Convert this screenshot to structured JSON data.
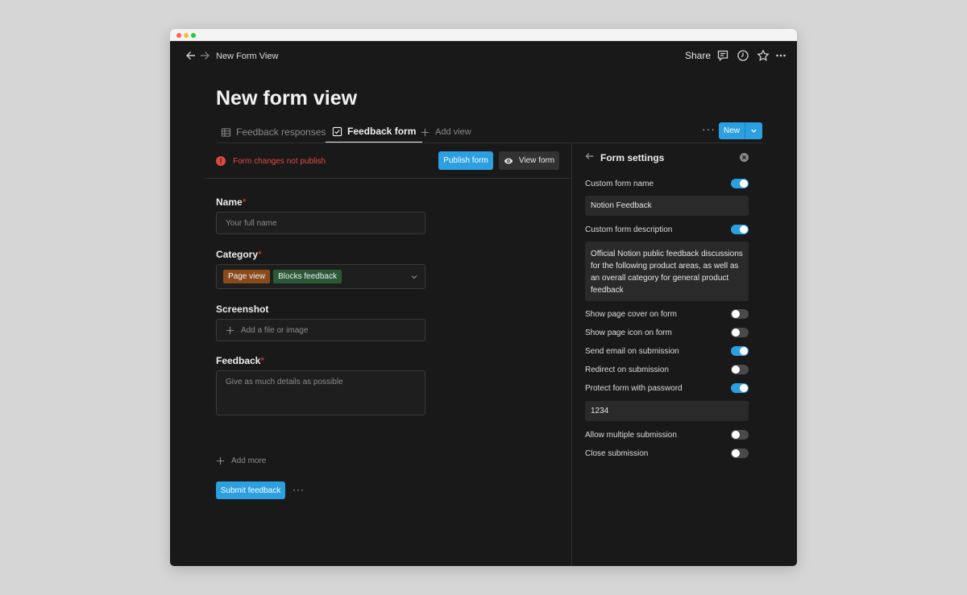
{
  "breadcrumb": "New Form View",
  "topbar": {
    "share_label": "Share"
  },
  "page_title": "New form view",
  "tabs": [
    {
      "label": "Feedback responses"
    },
    {
      "label": "Feedback form"
    }
  ],
  "add_view_label": "Add view",
  "new_button_label": "New",
  "warning_text": "Form changes not publish",
  "publish_label": "Publish form",
  "view_form_label": "View form",
  "form": {
    "name_label": "Name",
    "name_placeholder": "Your full name",
    "category_label": "Category",
    "category_tags": [
      "Page view",
      "Blocks feedback"
    ],
    "screenshot_label": "Screenshot",
    "screenshot_placeholder": "Add a file or image",
    "feedback_label": "Feedback",
    "feedback_placeholder": "Give as much details as possible",
    "required_mark": "*",
    "add_more_label": "Add more",
    "submit_label": "Submit feedback"
  },
  "settings": {
    "title": "Form settings",
    "rows": [
      {
        "label": "Custom form name",
        "on": true
      },
      {
        "label": "Custom form description",
        "on": true
      },
      {
        "label": "Show page cover on form",
        "on": false
      },
      {
        "label": "Show page icon on form",
        "on": false
      },
      {
        "label": "Send email on submission",
        "on": true
      },
      {
        "label": "Redirect on submission",
        "on": false
      },
      {
        "label": "Protect form with password",
        "on": true
      },
      {
        "label": "Allow multiple submission",
        "on": false
      },
      {
        "label": "Close submission",
        "on": false
      }
    ],
    "form_name_value": "Notion Feedback",
    "form_description_value": "Official Notion public feedback discussions for the following product areas, as well as an overall category for general product feedback",
    "password_value": "1234"
  },
  "colors": {
    "accent": "#2c9fe0",
    "warning": "#e24a42",
    "background": "#191919"
  }
}
